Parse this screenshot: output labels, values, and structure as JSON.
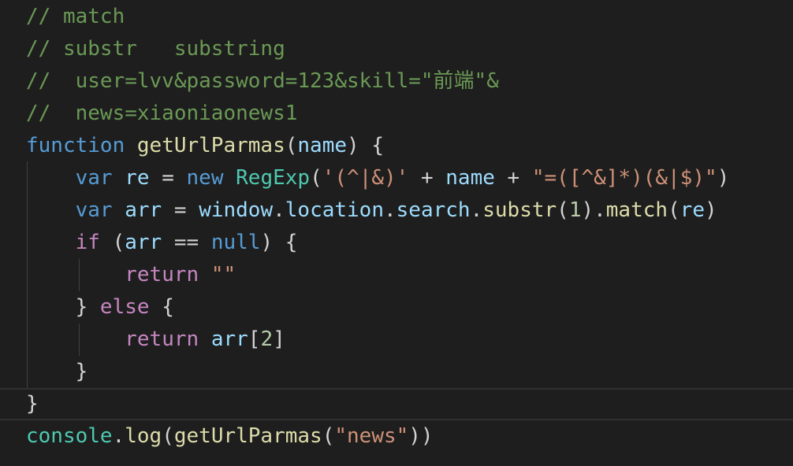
{
  "editor": {
    "lines": [
      {
        "current": false,
        "tokens": [
          {
            "t": "// match",
            "k": "comment"
          }
        ]
      },
      {
        "current": false,
        "tokens": [
          {
            "t": "// substr   substring",
            "k": "comment"
          }
        ]
      },
      {
        "current": false,
        "tokens": [
          {
            "t": "//  user=lvv&password=123&skill=\"前端\"&",
            "k": "comment"
          }
        ]
      },
      {
        "current": false,
        "tokens": [
          {
            "t": "//  news=xiaoniaonews1",
            "k": "comment"
          }
        ]
      },
      {
        "current": false,
        "tokens": [
          {
            "t": "function",
            "k": "keyword"
          },
          {
            "t": " ",
            "k": "plain"
          },
          {
            "t": "getUrlParmas",
            "k": "func"
          },
          {
            "t": "(",
            "k": "plain"
          },
          {
            "t": "name",
            "k": "var"
          },
          {
            "t": ") {",
            "k": "plain"
          }
        ]
      },
      {
        "current": false,
        "tokens": [
          {
            "t": "    ",
            "k": "plain"
          },
          {
            "t": "var",
            "k": "keyword"
          },
          {
            "t": " ",
            "k": "plain"
          },
          {
            "t": "re",
            "k": "var"
          },
          {
            "t": " = ",
            "k": "plain"
          },
          {
            "t": "new",
            "k": "keyword"
          },
          {
            "t": " ",
            "k": "plain"
          },
          {
            "t": "RegExp",
            "k": "class"
          },
          {
            "t": "(",
            "k": "plain"
          },
          {
            "t": "'(^|&)'",
            "k": "string"
          },
          {
            "t": " + ",
            "k": "plain"
          },
          {
            "t": "name",
            "k": "var"
          },
          {
            "t": " + ",
            "k": "plain"
          },
          {
            "t": "\"=([^&]*)(&|$)\"",
            "k": "string"
          },
          {
            "t": ")",
            "k": "plain"
          }
        ]
      },
      {
        "current": false,
        "tokens": [
          {
            "t": "    ",
            "k": "plain"
          },
          {
            "t": "var",
            "k": "keyword"
          },
          {
            "t": " ",
            "k": "plain"
          },
          {
            "t": "arr",
            "k": "var"
          },
          {
            "t": " = ",
            "k": "plain"
          },
          {
            "t": "window",
            "k": "var"
          },
          {
            "t": ".",
            "k": "plain"
          },
          {
            "t": "location",
            "k": "var"
          },
          {
            "t": ".",
            "k": "plain"
          },
          {
            "t": "search",
            "k": "var"
          },
          {
            "t": ".",
            "k": "plain"
          },
          {
            "t": "substr",
            "k": "func"
          },
          {
            "t": "(",
            "k": "plain"
          },
          {
            "t": "1",
            "k": "number"
          },
          {
            "t": ").",
            "k": "plain"
          },
          {
            "t": "match",
            "k": "func"
          },
          {
            "t": "(",
            "k": "plain"
          },
          {
            "t": "re",
            "k": "var"
          },
          {
            "t": ")",
            "k": "plain"
          }
        ]
      },
      {
        "current": false,
        "tokens": [
          {
            "t": "    ",
            "k": "plain"
          },
          {
            "t": "if",
            "k": "control"
          },
          {
            "t": " (",
            "k": "plain"
          },
          {
            "t": "arr",
            "k": "var"
          },
          {
            "t": " == ",
            "k": "plain"
          },
          {
            "t": "null",
            "k": "keyword"
          },
          {
            "t": ") {",
            "k": "plain"
          }
        ]
      },
      {
        "current": false,
        "tokens": [
          {
            "t": "        ",
            "k": "plain"
          },
          {
            "t": "return",
            "k": "control"
          },
          {
            "t": " ",
            "k": "plain"
          },
          {
            "t": "\"\"",
            "k": "string"
          }
        ]
      },
      {
        "current": false,
        "tokens": [
          {
            "t": "    } ",
            "k": "plain"
          },
          {
            "t": "else",
            "k": "control"
          },
          {
            "t": " {",
            "k": "plain"
          }
        ]
      },
      {
        "current": false,
        "tokens": [
          {
            "t": "        ",
            "k": "plain"
          },
          {
            "t": "return",
            "k": "control"
          },
          {
            "t": " ",
            "k": "plain"
          },
          {
            "t": "arr",
            "k": "var"
          },
          {
            "t": "[",
            "k": "plain"
          },
          {
            "t": "2",
            "k": "number"
          },
          {
            "t": "]",
            "k": "plain"
          }
        ]
      },
      {
        "current": false,
        "tokens": [
          {
            "t": "    }",
            "k": "plain"
          }
        ]
      },
      {
        "current": true,
        "tokens": [
          {
            "t": "}",
            "k": "plain"
          }
        ]
      },
      {
        "current": false,
        "tokens": [
          {
            "t": "console",
            "k": "class"
          },
          {
            "t": ".",
            "k": "plain"
          },
          {
            "t": "log",
            "k": "func"
          },
          {
            "t": "(",
            "k": "plain"
          },
          {
            "t": "getUrlParmas",
            "k": "func"
          },
          {
            "t": "(",
            "k": "plain"
          },
          {
            "t": "\"news\"",
            "k": "string"
          },
          {
            "t": "))",
            "k": "plain"
          }
        ]
      }
    ]
  },
  "colors": {
    "background": "#1e1e1e",
    "comment": "#6a9955",
    "keyword": "#569cd6",
    "control": "#c586c0",
    "function": "#dcdcaa",
    "variable": "#9cdcfe",
    "class": "#4ec9b0",
    "string": "#ce9178",
    "number": "#b5cea8",
    "plain": "#d4d4d4"
  }
}
